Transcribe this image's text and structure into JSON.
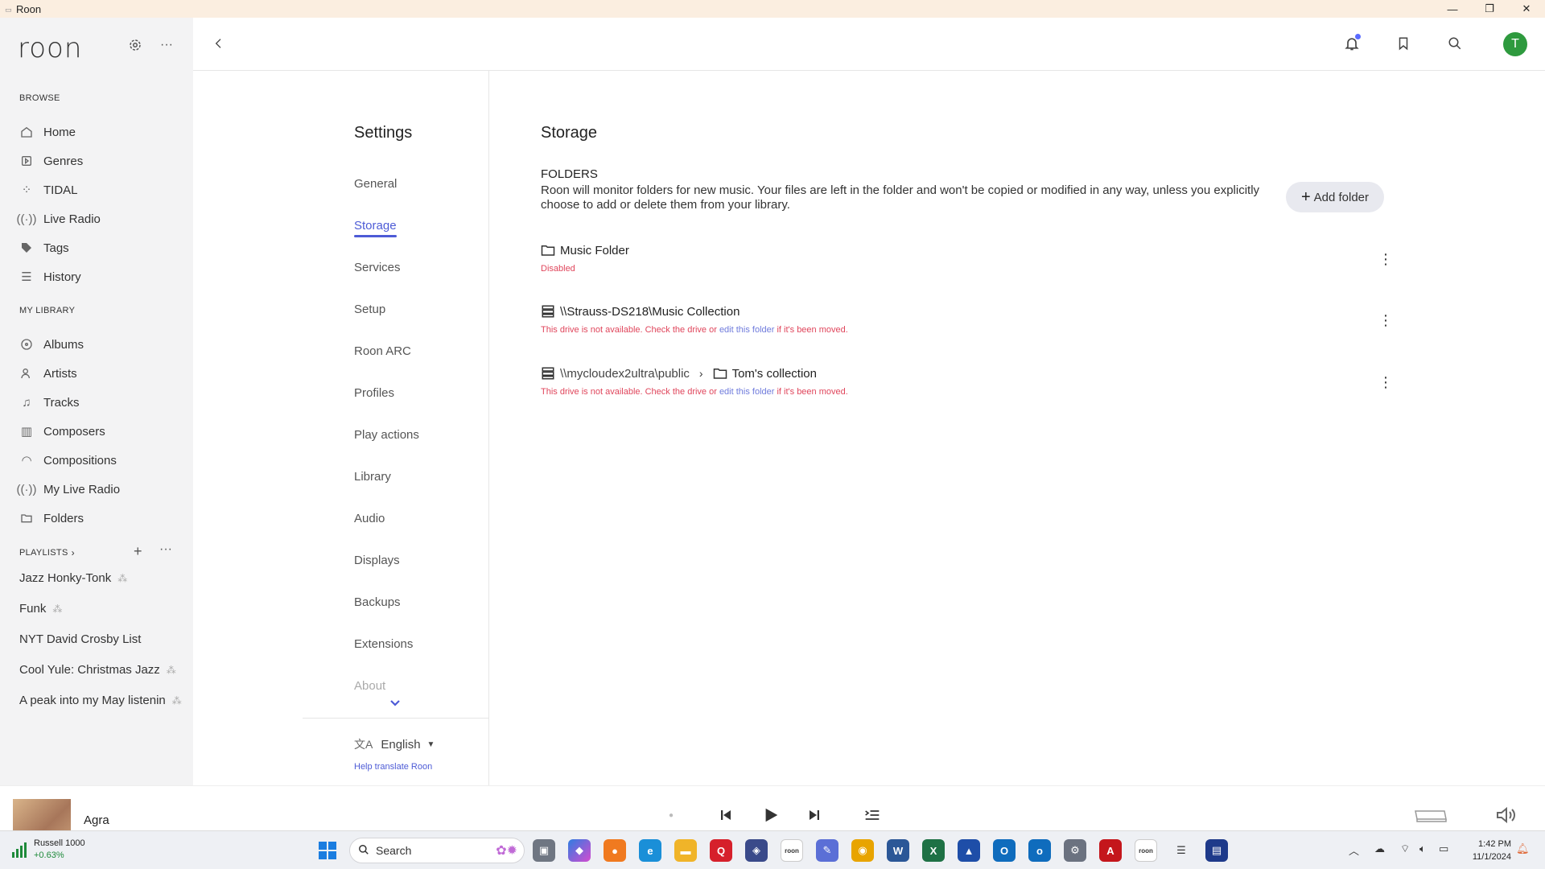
{
  "window": {
    "title": "Roon",
    "controls": [
      "minimize",
      "maximize",
      "close"
    ]
  },
  "sidebar": {
    "logo": "roon",
    "browse_heading": "BROWSE",
    "browse_items": [
      {
        "label": "Home",
        "icon": "home-icon"
      },
      {
        "label": "Genres",
        "icon": "genres-icon"
      },
      {
        "label": "TIDAL",
        "icon": "tidal-icon"
      },
      {
        "label": "Live Radio",
        "icon": "radio-icon"
      },
      {
        "label": "Tags",
        "icon": "tag-icon"
      },
      {
        "label": "History",
        "icon": "history-icon"
      }
    ],
    "library_heading": "MY LIBRARY",
    "library_items": [
      {
        "label": "Albums",
        "icon": "album-icon"
      },
      {
        "label": "Artists",
        "icon": "artist-icon"
      },
      {
        "label": "Tracks",
        "icon": "music-note-icon"
      },
      {
        "label": "Composers",
        "icon": "composer-icon"
      },
      {
        "label": "Compositions",
        "icon": "composition-icon"
      },
      {
        "label": "My Live Radio",
        "icon": "radio-icon"
      },
      {
        "label": "Folders",
        "icon": "folder-icon"
      }
    ],
    "playlists_heading": "PLAYLISTS",
    "playlists": [
      {
        "label": "Jazz Honky-Tonk"
      },
      {
        "label": "Funk"
      },
      {
        "label": "NYT David Crosby List"
      },
      {
        "label": "Cool Yule: Christmas Jazz"
      },
      {
        "label": "A peak into my May listenin"
      }
    ]
  },
  "settings_nav": {
    "title": "Settings",
    "items": [
      "General",
      "Storage",
      "Services",
      "Setup",
      "Roon ARC",
      "Profiles",
      "Play actions",
      "Library",
      "Audio",
      "Displays",
      "Backups",
      "Extensions",
      "About"
    ],
    "active": "Storage",
    "language": "English",
    "help_link": "Help translate Roon"
  },
  "storage": {
    "title": "Storage",
    "folders_heading": "FOLDERS",
    "folders_description": "Roon will monitor folders for new music. Your files are left in the folder and won't be copied or modified in any way, unless you explicitly choose to add or delete them from your library.",
    "add_folder_label": "Add folder",
    "folders": [
      {
        "name": "Music Folder",
        "status": "Disabled"
      },
      {
        "name": "\\\\Strauss-DS218\\Music Collection",
        "status_pre": "This drive is not available. Check the drive or ",
        "status_link": "edit this folder",
        "status_post": " if it's been moved."
      },
      {
        "path": "\\\\mycloudex2ultra\\public",
        "name": "Tom's collection",
        "status_pre": "This drive is not available. Check the drive or ",
        "status_link": "edit this folder",
        "status_post": " if it's been moved."
      }
    ]
  },
  "player": {
    "track_title": "Agra"
  },
  "taskbar": {
    "stock_name": "Russell 1000",
    "stock_change": "+0.63%",
    "search_label": "Search",
    "time": "1:42 PM",
    "date": "11/1/2024"
  },
  "colors": {
    "accent": "#4d5bd6",
    "error": "#e0465c",
    "avatar": "#2e9a3e"
  },
  "header": {
    "avatar_initial": "T"
  }
}
